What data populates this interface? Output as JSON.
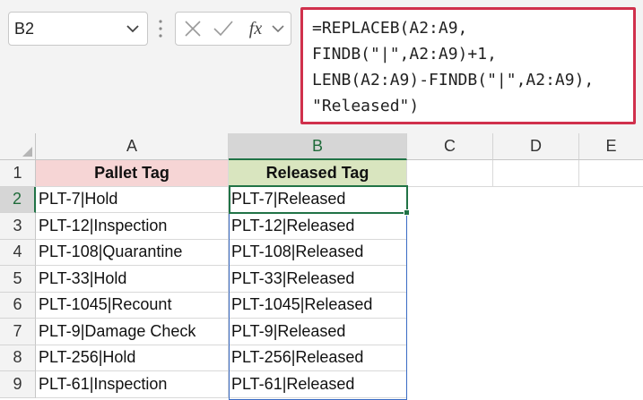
{
  "name_box": {
    "value": "B2"
  },
  "formula_bar": {
    "fx_label": "fx",
    "formula_lines": [
      "=REPLACEB(A2:A9,",
      "FINDB(\"|\",A2:A9)+1,",
      "LENB(A2:A9)-FINDB(\"|\",A2:A9),",
      "\"Released\")"
    ]
  },
  "columns": [
    "A",
    "B",
    "C",
    "D",
    "E"
  ],
  "rows": [
    "1",
    "2",
    "3",
    "4",
    "5",
    "6",
    "7",
    "8",
    "9"
  ],
  "header_row": {
    "a": "Pallet Tag",
    "b": "Released Tag"
  },
  "data_rows": [
    {
      "a": "PLT-7|Hold",
      "b": "PLT-7|Released"
    },
    {
      "a": "PLT-12|Inspection",
      "b": "PLT-12|Released"
    },
    {
      "a": "PLT-108|Quarantine",
      "b": "PLT-108|Released"
    },
    {
      "a": "PLT-33|Hold",
      "b": "PLT-33|Released"
    },
    {
      "a": "PLT-1045|Recount",
      "b": "PLT-1045|Released"
    },
    {
      "a": "PLT-9|Damage Check",
      "b": "PLT-9|Released"
    },
    {
      "a": "PLT-256|Hold",
      "b": "PLT-256|Released"
    },
    {
      "a": "PLT-61|Inspection",
      "b": "PLT-61|Released"
    }
  ],
  "colors": {
    "formula_highlight": "#d0304c",
    "header_a_fill": "#f6d5d5",
    "header_b_fill": "#d9e5bf",
    "active_cell": "#217346",
    "selection": "#3b6cc4"
  }
}
